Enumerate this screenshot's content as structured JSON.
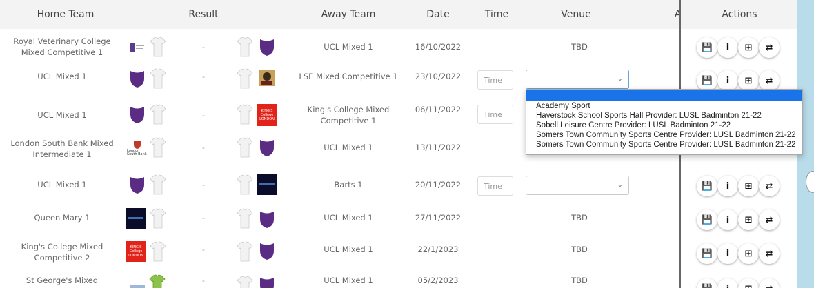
{
  "header": {
    "home_team": "Home Team",
    "result": "Result",
    "away_team": "Away Team",
    "date": "Date",
    "time": "Time",
    "venue": "Venue",
    "extra": "A",
    "actions": "Actions"
  },
  "rows": [
    {
      "home": "Royal Veterinary College Mixed Competitive 1",
      "result": "-",
      "away": "UCL Mixed 1",
      "date": "16/10/2022",
      "venue": "TBD"
    },
    {
      "home": "UCL Mixed 1",
      "result": "-",
      "away": "LSE Mixed Competitive 1",
      "date": "23/10/2022",
      "time_placeholder": "Time"
    },
    {
      "home": "UCL Mixed 1",
      "result": "-",
      "away": "King's College Mixed Competitive 1",
      "date": "06/11/2022",
      "time_placeholder": "Time"
    },
    {
      "home": "London South Bank Mixed Intermediate 1",
      "result": "-",
      "away": "UCL Mixed 1",
      "date": "13/11/2022"
    },
    {
      "home": "UCL Mixed 1",
      "result": "-",
      "away": "Barts 1",
      "date": "20/11/2022",
      "time_placeholder": "Time"
    },
    {
      "home": "Queen Mary 1",
      "result": "-",
      "away": "UCL Mixed 1",
      "date": "27/11/2022",
      "venue": "TBD"
    },
    {
      "home": "King's College Mixed Competitive 2",
      "result": "-",
      "away": "UCL Mixed 1",
      "date": "22/1/2023",
      "venue": "TBD"
    },
    {
      "home": "St George's Mixed",
      "result": "-",
      "away": "UCL Mixed 1",
      "date": "05/2/2023",
      "venue": "TBD"
    }
  ],
  "venue_options": [
    "Academy Sport",
    "Haverstock School Sports Hall Provider: LUSL Badminton 21-22",
    "Sobell Leisure Centre Provider: LUSL Badminton 21-22",
    "Somers Town Community Sports Centre Provider: LUSL Badminton 21-22",
    "Somers Town Community Sports Centre Provider: LUSL Badminton 21-22"
  ],
  "icons": {
    "save": "floppy-icon",
    "info": "info-icon",
    "table": "table-icon",
    "swap": "swap-icon"
  },
  "crest_text": {
    "kings": "KING'S College LONDON",
    "london_south_bank": "London South Bank"
  },
  "colors": {
    "ucl_purple": "#5b2c83",
    "kings_red": "#e2231a",
    "qm_navy": "#0b0b2a",
    "dropdown_highlight": "#1a73e8"
  }
}
